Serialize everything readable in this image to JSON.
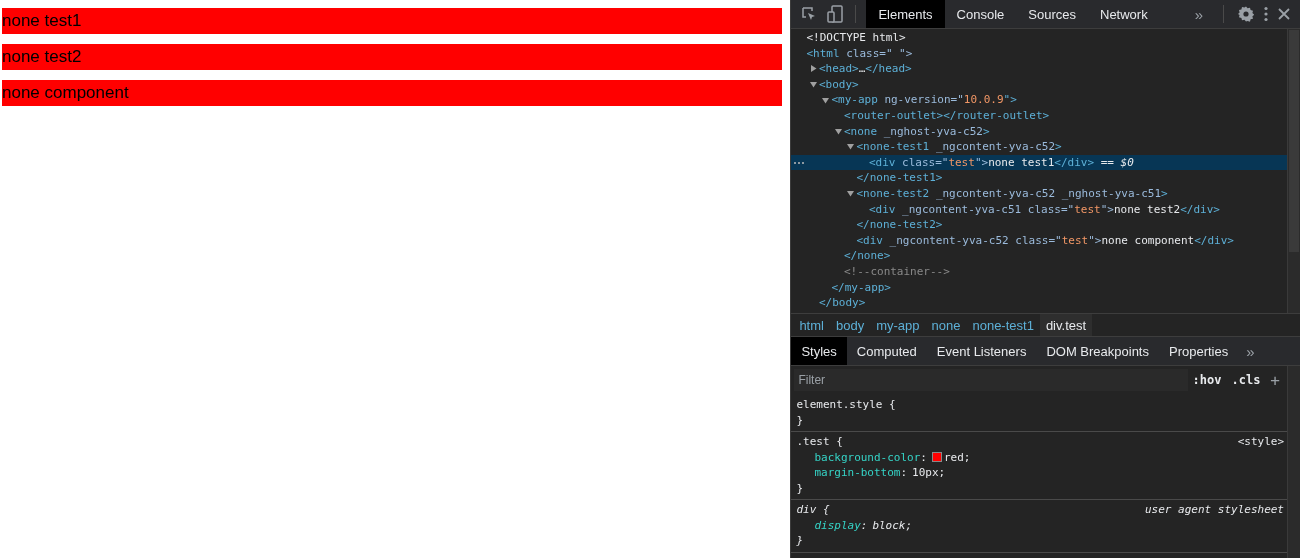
{
  "page": {
    "blocks": [
      "none test1",
      "none test2",
      "none component"
    ]
  },
  "devtools": {
    "tabs": [
      {
        "label": "Elements",
        "selected": true
      },
      {
        "label": "Console",
        "selected": false
      },
      {
        "label": "Sources",
        "selected": false
      },
      {
        "label": "Network",
        "selected": false
      }
    ],
    "tabs_more": "»",
    "dom": [
      {
        "tokens": [
          {
            "kind": "doctype",
            "text": "<!DOCTYPE html>"
          }
        ]
      },
      {
        "tokens": [
          {
            "kind": "tag",
            "text": "<html "
          },
          {
            "kind": "attr",
            "text": "class=\" \">"
          }
        ],
        "children": [
          {
            "expanded": false,
            "tokens": [
              {
                "kind": "tag",
                "text": "<head>"
              },
              {
                "kind": "text",
                "text": "…"
              },
              {
                "kind": "tag",
                "text": "</head>"
              }
            ]
          },
          {
            "expanded": true,
            "tokens": [
              {
                "kind": "tag",
                "text": "<body>"
              }
            ],
            "children": [
              {
                "expanded": true,
                "tokens": [
                  {
                    "kind": "tag",
                    "text": "<my-app "
                  },
                  {
                    "kind": "attr",
                    "text": "ng-version=\""
                  },
                  {
                    "kind": "value",
                    "text": "10.0.9"
                  },
                  {
                    "kind": "tag",
                    "text": "\">"
                  }
                ],
                "children": [
                  {
                    "tokens": [
                      {
                        "kind": "tag",
                        "text": "<router-outlet></router-outlet>"
                      }
                    ]
                  },
                  {
                    "expanded": true,
                    "tokens": [
                      {
                        "kind": "tag",
                        "text": "<none "
                      },
                      {
                        "kind": "attr",
                        "text": "_nghost-yva-c52"
                      },
                      {
                        "kind": "tag",
                        "text": ">"
                      }
                    ],
                    "children": [
                      {
                        "expanded": true,
                        "tokens": [
                          {
                            "kind": "tag",
                            "text": "<none-test1 "
                          },
                          {
                            "kind": "attr",
                            "text": "_ngcontent-yva-c52"
                          },
                          {
                            "kind": "tag",
                            "text": ">"
                          }
                        ],
                        "children": [
                          {
                            "selected": true,
                            "tokens": [
                              {
                                "kind": "tag",
                                "text": "<div "
                              },
                              {
                                "kind": "attr",
                                "text": "class=\""
                              },
                              {
                                "kind": "value",
                                "text": "test"
                              },
                              {
                                "kind": "attr",
                                "text": "\">"
                              },
                              {
                                "kind": "text",
                                "text": "none test1"
                              },
                              {
                                "kind": "tag",
                                "text": "</div>"
                              },
                              {
                                "kind": "text",
                                "text": " == "
                              },
                              {
                                "kind": "ref",
                                "text": "$0"
                              }
                            ]
                          }
                        ],
                        "close": "</none-test1>"
                      },
                      {
                        "expanded": true,
                        "tokens": [
                          {
                            "kind": "tag",
                            "text": "<none-test2 "
                          },
                          {
                            "kind": "attr",
                            "text": "_ngcontent-yva-c52 _nghost-yva-c51"
                          },
                          {
                            "kind": "tag",
                            "text": ">"
                          }
                        ],
                        "children": [
                          {
                            "tokens": [
                              {
                                "kind": "tag",
                                "text": "<div "
                              },
                              {
                                "kind": "attr",
                                "text": "_ngcontent-yva-c51 class=\""
                              },
                              {
                                "kind": "value",
                                "text": "test"
                              },
                              {
                                "kind": "attr",
                                "text": "\">"
                              },
                              {
                                "kind": "text",
                                "text": "none test2"
                              },
                              {
                                "kind": "tag",
                                "text": "</div>"
                              }
                            ]
                          }
                        ],
                        "close": "</none-test2>"
                      },
                      {
                        "tokens": [
                          {
                            "kind": "tag",
                            "text": "<div "
                          },
                          {
                            "kind": "attr",
                            "text": "_ngcontent-yva-c52 class=\""
                          },
                          {
                            "kind": "value",
                            "text": "test"
                          },
                          {
                            "kind": "attr",
                            "text": "\">"
                          },
                          {
                            "kind": "text",
                            "text": "none component"
                          },
                          {
                            "kind": "tag",
                            "text": "</div>"
                          }
                        ]
                      }
                    ],
                    "close": "</none>"
                  },
                  {
                    "tokens": [
                      {
                        "kind": "comment",
                        "text": "<!--container-->"
                      }
                    ]
                  }
                ],
                "close": "</my-app>"
              }
            ],
            "close": "</body>"
          }
        ]
      }
    ],
    "breadcrumbs": [
      {
        "label": "html",
        "selected": false
      },
      {
        "label": "body",
        "selected": false
      },
      {
        "label": "my-app",
        "selected": false
      },
      {
        "label": "none",
        "selected": false
      },
      {
        "label": "none-test1",
        "selected": false
      },
      {
        "label": "div.test",
        "selected": true
      }
    ],
    "pane_tabs": [
      {
        "label": "Styles",
        "selected": true
      },
      {
        "label": "Computed",
        "selected": false
      },
      {
        "label": "Event Listeners",
        "selected": false
      },
      {
        "label": "DOM Breakpoints",
        "selected": false
      },
      {
        "label": "Properties",
        "selected": false
      }
    ],
    "pane_tabs_more": "»",
    "filter": {
      "placeholder": "Filter"
    },
    "hov": ":hov",
    "cls": ".cls",
    "add": "+",
    "rules": [
      {
        "kind": "inline",
        "selector": "element.style {",
        "end": "}"
      },
      {
        "kind": "author",
        "selector": ".test {",
        "source": "<style>",
        "declarations": [
          {
            "property": "background-color",
            "colon": ":",
            "value": "red;",
            "color": "#ff0000"
          },
          {
            "property": "margin-bottom",
            "colon": ":",
            "value": "10px;"
          }
        ],
        "end": "}"
      },
      {
        "kind": "user-agent",
        "selector": "div {",
        "source": "user agent stylesheet",
        "declarations": [
          {
            "property": "display",
            "colon": ":",
            "value": "block;"
          }
        ],
        "end": "}"
      }
    ]
  }
}
